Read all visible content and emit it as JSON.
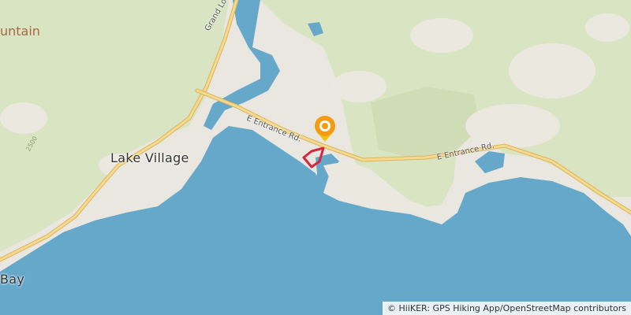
{
  "map": {
    "colors": {
      "water": "#65a8c9",
      "forest": "#d8e4c2",
      "land": "#e9e7df",
      "road": "#f6d98e",
      "road_outline": "#d9b55c",
      "trail": "#d7263d",
      "marker": "#f39c12"
    },
    "place_labels": {
      "lake_village": "Lake Village",
      "bay": "Bay",
      "mountain": "untain"
    },
    "road_labels": {
      "grand_loop": "Grand Loop Road",
      "east_entrance_west": "E Entrance Rd.",
      "east_entrance_east": "E Entrance Rd."
    },
    "contour_label": "2500",
    "marker_icon": "location-pin-icon",
    "attribution": "© HiiKER: GPS Hiking App/OpenStreetMap contributors"
  }
}
